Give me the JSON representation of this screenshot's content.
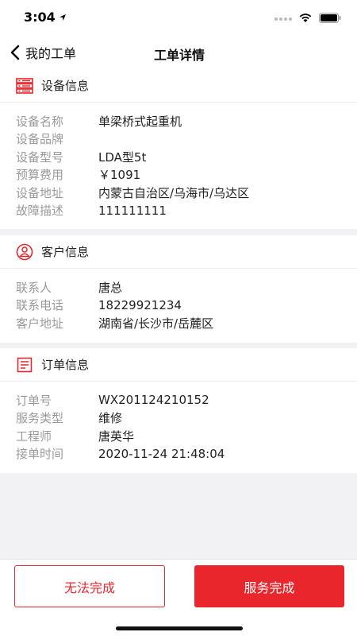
{
  "status_bar": {
    "time": "3:04"
  },
  "nav": {
    "back_label": "我的工单",
    "title": "工单详情"
  },
  "colors": {
    "accent": "#e8262c",
    "label_gray": "#9a9a9a",
    "background": "#f2f2f4"
  },
  "device_section": {
    "title": "设备信息",
    "icon": "server-icon",
    "rows": [
      {
        "label": "设备名称",
        "value": "单梁桥式起重机"
      },
      {
        "label": "设备品牌",
        "value": ""
      },
      {
        "label": "设备型号",
        "value": "LDA型5t"
      },
      {
        "label": "预算费用",
        "value": "￥1091"
      },
      {
        "label": "设备地址",
        "value": "内蒙古自治区/乌海市/乌达区"
      },
      {
        "label": "故障描述",
        "value": "111111111"
      }
    ]
  },
  "customer_section": {
    "title": "客户信息",
    "icon": "customer-icon",
    "rows": [
      {
        "label": "联系人",
        "value": "唐总"
      },
      {
        "label": "联系电话",
        "value": "18229921234"
      },
      {
        "label": "客户地址",
        "value": "湖南省/长沙市/岳麓区"
      }
    ]
  },
  "order_section": {
    "title": "订单信息",
    "icon": "document-list-icon",
    "rows": [
      {
        "label": "订单号",
        "value": "WX201124210152"
      },
      {
        "label": "服务类型",
        "value": "维修"
      },
      {
        "label": "工程师",
        "value": "唐英华"
      },
      {
        "label": "接单时间",
        "value": "2020-11-24 21:48:04"
      }
    ]
  },
  "actions": {
    "cannot_complete": "无法完成",
    "service_complete": "服务完成"
  }
}
